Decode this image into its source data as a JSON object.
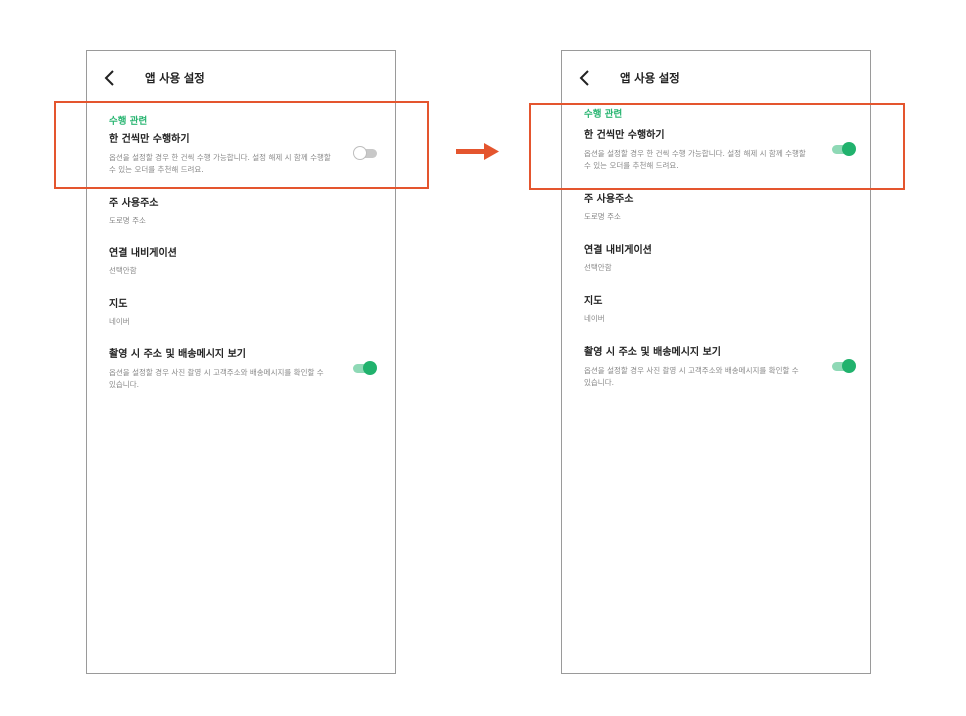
{
  "header": {
    "title": "앱 사용 설정"
  },
  "section": {
    "label": "수행 관련"
  },
  "items": {
    "single_order": {
      "title": "한 건씩만 수행하기",
      "desc_line1": "옵션을 설정할 경우 한 건씩 수행 가능합니다. 설정 해제 시 함께 수행할",
      "desc_line2": "수 있는 오더를 추천해 드려요."
    },
    "main_address": {
      "title": "주 사용주소",
      "value": "도로명 주소"
    },
    "navigation": {
      "title": "연결 내비게이션",
      "value": "선택안함"
    },
    "map": {
      "title": "지도",
      "value": "네이버"
    },
    "photo_address": {
      "title": "촬영 시 주소 및 배송메시지 보기",
      "desc_line1": "옵션을 설정할 경우 사진 촬영 시 고객주소와 배송메시지를 확인할 수",
      "desc_line2": "있습니다."
    }
  },
  "states": {
    "before": {
      "single_order_on": false,
      "photo_address_on": true
    },
    "after": {
      "single_order_on": true,
      "photo_address_on": true
    }
  },
  "colors": {
    "accent_green": "#21b26d",
    "highlight_red": "#e4552e",
    "toggle_off": "#c8c8c8"
  }
}
